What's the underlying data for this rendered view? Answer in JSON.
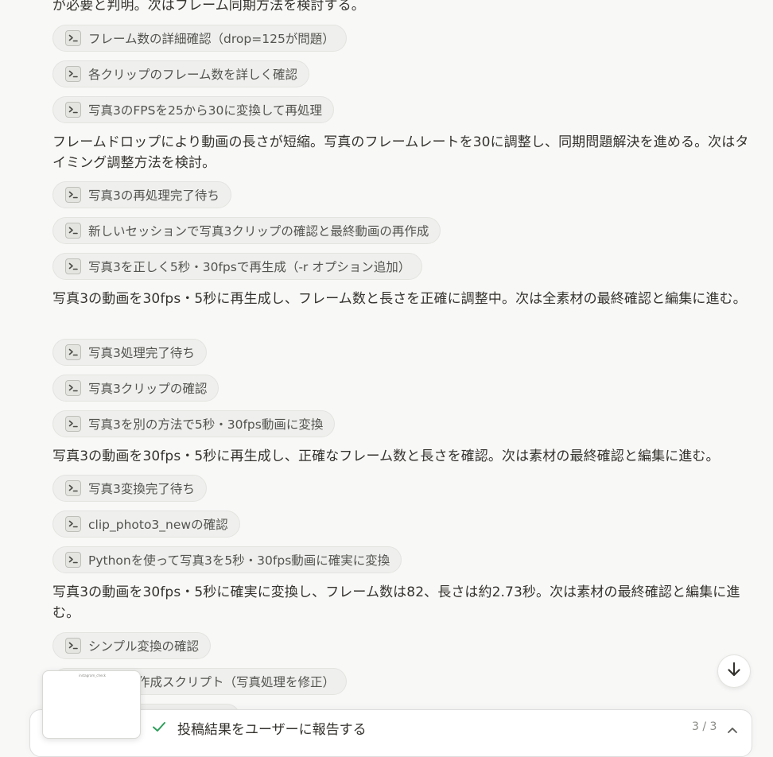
{
  "feed": {
    "items": [
      {
        "kind": "para",
        "text": "が必要と判明。次はフレーム同期方法を検討する。"
      },
      {
        "kind": "chip",
        "icon": "terminal-icon",
        "label": "フレーム数の詳細確認（drop=125が問題）"
      },
      {
        "kind": "chip",
        "icon": "terminal-icon",
        "label": "各クリップのフレーム数を詳しく確認"
      },
      {
        "kind": "chip",
        "icon": "terminal-icon",
        "label": "写真3のFPSを25から30に変換して再処理"
      },
      {
        "kind": "para",
        "text": "フレームドロップにより動画の長さが短縮。写真のフレームレートを30に調整し、同期問題解決を進める。次はタイミング調整方法を検討。"
      },
      {
        "kind": "chip",
        "icon": "terminal-icon",
        "label": "写真3の再処理完了待ち"
      },
      {
        "kind": "chip",
        "icon": "terminal-icon",
        "label": "新しいセッションで写真3クリップの確認と最終動画の再作成"
      },
      {
        "kind": "chip",
        "icon": "terminal-icon",
        "label": "写真3を正しく5秒・30fpsで再生成（-r オプション追加）"
      },
      {
        "kind": "para",
        "text": "写真3の動画を30fps・5秒に再生成し、フレーム数と長さを正確に調整中。次は全素材の最終確認と編集に進む。"
      },
      {
        "kind": "chip",
        "icon": "terminal-icon",
        "label": "写真3処理完了待ち"
      },
      {
        "kind": "chip",
        "icon": "terminal-icon",
        "label": "写真3クリップの確認"
      },
      {
        "kind": "chip",
        "icon": "terminal-icon",
        "label": "写真3を別の方法で5秒・30fps動画に変換"
      },
      {
        "kind": "para",
        "text": "写真3の動画を30fps・5秒に再生成し、正確なフレーム数と長さを確認。次は素材の最終確認と編集に進む。"
      },
      {
        "kind": "chip",
        "icon": "terminal-icon",
        "label": "写真3変換完了待ち"
      },
      {
        "kind": "chip",
        "icon": "terminal-icon",
        "label": "clip_photo3_newの確認"
      },
      {
        "kind": "chip",
        "icon": "terminal-icon",
        "label": "Pythonを使って写真3を5秒・30fps動画に確実に変換"
      },
      {
        "kind": "para",
        "text": "写真3の動画を30fps・5秒に確実に変換し、フレーム数は82、長さは約2.73秒。次は素材の最終確認と編集に進む。"
      },
      {
        "kind": "chip",
        "icon": "terminal-icon",
        "label": "シンプル変換の確認"
      },
      {
        "kind": "chip",
        "icon": "terminal-icon",
        "label": "ール動画作成スクリプト（写真処理を修正）"
      }
    ]
  },
  "status_bar": {
    "icon": "check-icon",
    "label": "投稿結果をユーザーに報告する",
    "step_count": "3 / 3",
    "expand_icon": "chevron-up-icon",
    "accent_color": "#2e9e5b"
  },
  "scroll_button": {
    "icon": "arrow-down-icon"
  },
  "thumbnail": {
    "caption": "instagram_check"
  }
}
